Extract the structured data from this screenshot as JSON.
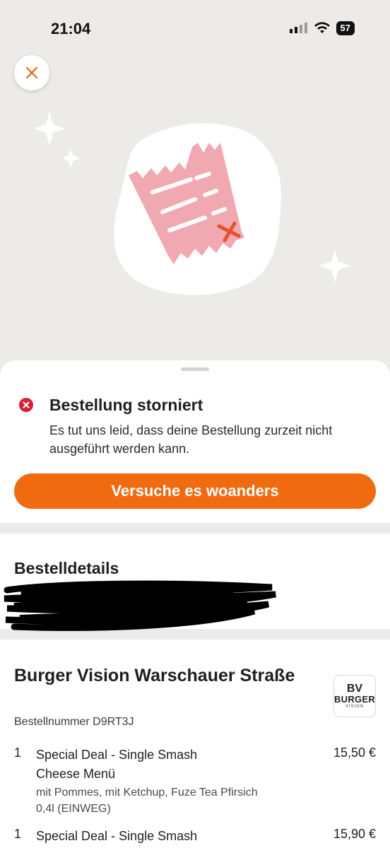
{
  "status_bar": {
    "time": "21:04",
    "battery": "57"
  },
  "cancel": {
    "title": "Bestellung storniert",
    "message": "Es tut uns leid, dass deine Bestellung zurzeit nicht ausgeführt werden kann.",
    "cta_label": "Versuche es woanders"
  },
  "details": {
    "title": "Bestelldetails"
  },
  "order": {
    "restaurant": "Burger Vision Warschauer Straße",
    "order_number": "Bestellnummer D9RT3J",
    "logo": {
      "mono": "BV",
      "text": "BURGER",
      "sub": "VISION"
    },
    "items": [
      {
        "qty": "1",
        "name": "Special Deal - Single Smash Cheese Menü",
        "options": "mit Pommes, mit Ketchup, Fuze Tea Pfirsich 0,4l (EINWEG)",
        "price": "15,50 €"
      },
      {
        "qty": "1",
        "name": "Special Deal - Single Smash",
        "price": "15,90 €"
      }
    ]
  },
  "colors": {
    "accent": "#f06a0f",
    "error": "#d91f36",
    "receipt": "#f1a9b1"
  }
}
